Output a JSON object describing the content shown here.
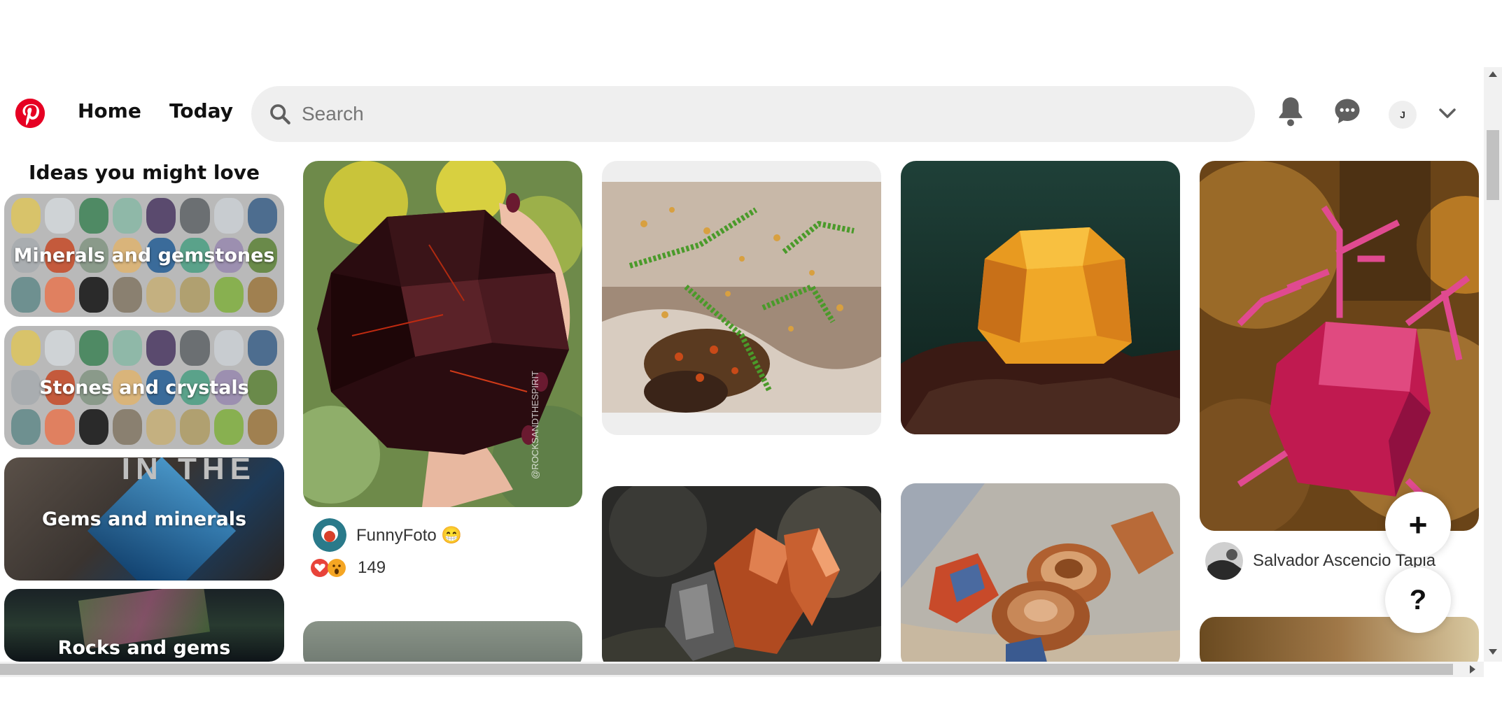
{
  "header": {
    "nav": [
      "Home",
      "Today"
    ],
    "search_placeholder": "Search",
    "avatar_initial": "J"
  },
  "sidebar": {
    "title": "Ideas you might love",
    "cards": [
      "Minerals and gemstones",
      "Stones and crystals",
      "Gems and minerals",
      "Rocks and gems"
    ],
    "gems_overlay_text": "IN THE"
  },
  "pins": {
    "pin1_author": "FunnyFoto 😁",
    "pin1_reaction_count": "149",
    "pin1_watermark": "@ROCKSANDTHESPIRIT",
    "pin4_author": "Salvador Ascencio Tapia"
  },
  "buttons": {
    "create": "+",
    "help": "?"
  },
  "colors": {
    "brand": "#e60023",
    "search_bg": "#efefef"
  }
}
